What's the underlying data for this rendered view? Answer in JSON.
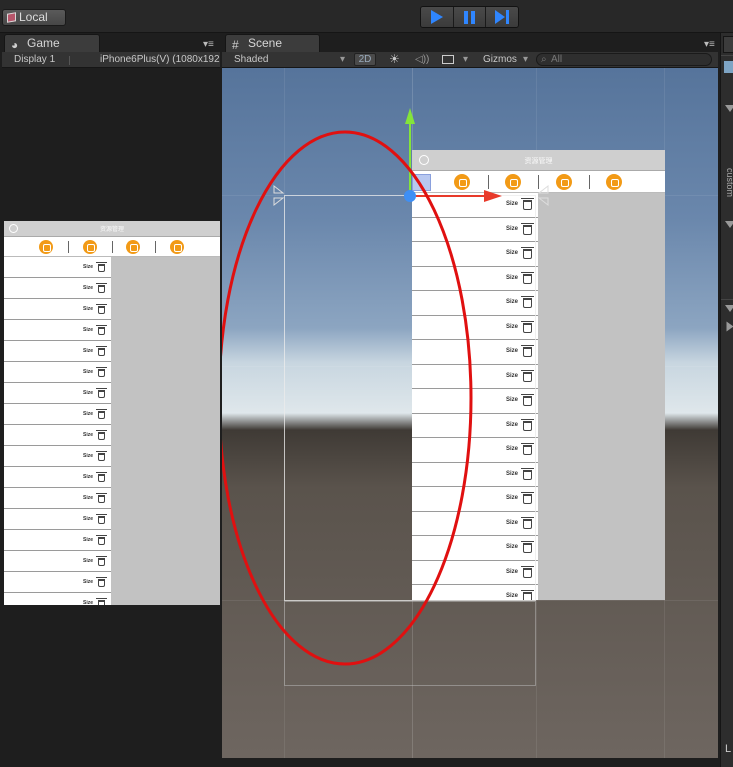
{
  "toolbar": {
    "local_label": "Local",
    "play_color": "#2f86ff"
  },
  "game_panel": {
    "tab_label": "Game",
    "display": "Display 1",
    "resolution": "iPhone6Plus(V) (1080x192"
  },
  "scene_panel": {
    "tab_label": "Scene",
    "shading": "Shaded",
    "mode_2d": "2D",
    "gizmos": "Gizmos",
    "search_placeholder": "All"
  },
  "right_panel": {
    "vertical_text": "custom",
    "bottom_text": "L"
  },
  "game_phone": {
    "rows": [
      "Size",
      "Size",
      "Size",
      "Size",
      "Size",
      "Size",
      "Size",
      "Size",
      "Size",
      "Size",
      "Size",
      "Size",
      "Size",
      "Size",
      "Size",
      "Size",
      "Size"
    ]
  },
  "scene_phone": {
    "rows": [
      "Size",
      "Size",
      "Size",
      "Size",
      "Size",
      "Size",
      "Size",
      "Size",
      "Size",
      "Size",
      "Size",
      "Size",
      "Size",
      "Size",
      "Size",
      "Size",
      "Size"
    ]
  },
  "colors": {
    "orange_icon": "#f29a16",
    "annotation_red": "#e01010",
    "gizmo_green": "#84e43a",
    "gizmo_red": "#e83a2a",
    "gizmo_blue": "#3e8ff5"
  }
}
